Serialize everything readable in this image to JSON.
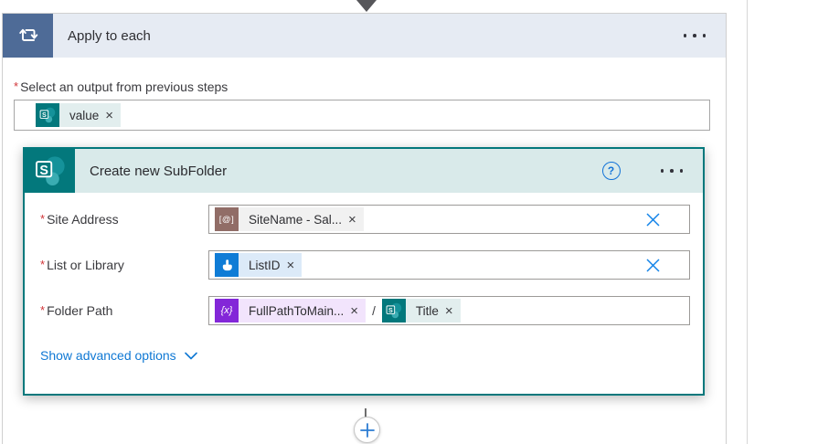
{
  "symbols": {
    "required": "*",
    "remove_token": "×",
    "help": "?"
  },
  "flow": {
    "apply_to_each": {
      "title": "Apply to each",
      "output_label": "Select an output from previous steps",
      "output_token": {
        "source": "sharepoint",
        "label": "value"
      }
    },
    "action_card": {
      "title": "Create new SubFolder",
      "fields": [
        {
          "label": "Site Address",
          "tokens": [
            {
              "type": "parameter",
              "icon_glyph": "[@]",
              "label": "SiteName - Sal..."
            }
          ],
          "clearable": true
        },
        {
          "label": "List or Library",
          "tokens": [
            {
              "type": "manual-trigger",
              "label": "ListID"
            }
          ],
          "clearable": true
        },
        {
          "label": "Folder Path",
          "tokens": [
            {
              "type": "variable",
              "icon_glyph": "{x}",
              "label": "FullPathToMain..."
            },
            {
              "type": "sharepoint",
              "label": "Title"
            }
          ],
          "separator": "/",
          "clearable": false
        }
      ],
      "advanced_options_label": "Show advanced options"
    }
  },
  "colors": {
    "scope_accent": "#4e6b97",
    "scope_header_bg": "#e6ebf3",
    "sharepoint_teal": "#03787c",
    "card_header_bg": "#d9eaea",
    "parameter_maroon": "#916d67",
    "manual_blue": "#0f7cd6",
    "variable_purple": "#8327d8",
    "link_blue": "#0f78d4",
    "required_red": "#d13438"
  }
}
